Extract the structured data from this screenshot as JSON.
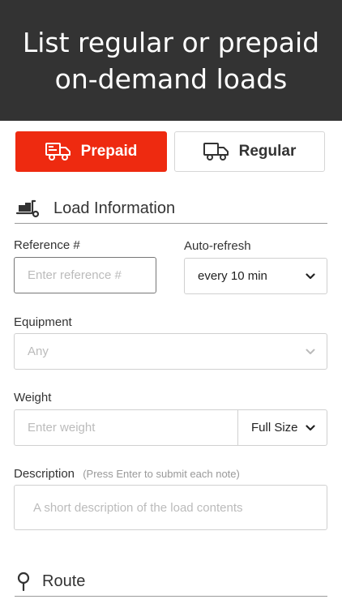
{
  "banner": {
    "title": "List regular or prepaid on-demand loads"
  },
  "toggle": {
    "prepaid_label": "Prepaid",
    "regular_label": "Regular",
    "active_color": "#ee2a10"
  },
  "load_section": {
    "title": "Load Information"
  },
  "reference": {
    "label": "Reference #",
    "placeholder": "Enter reference #"
  },
  "auto_refresh": {
    "label": "Auto-refresh",
    "value": "every 10 min"
  },
  "equipment": {
    "label": "Equipment",
    "value": "Any"
  },
  "weight": {
    "label": "Weight",
    "placeholder": "Enter weight",
    "size_value": "Full Size"
  },
  "description": {
    "label": "Description",
    "hint": "(Press Enter to submit each note)",
    "placeholder": "A short description of the load contents"
  },
  "route_section": {
    "title": "Route"
  },
  "icons": [
    "truck-box-icon",
    "truck-icon",
    "dolly-icon",
    "location-pin-icon",
    "chevron-down-icon"
  ]
}
